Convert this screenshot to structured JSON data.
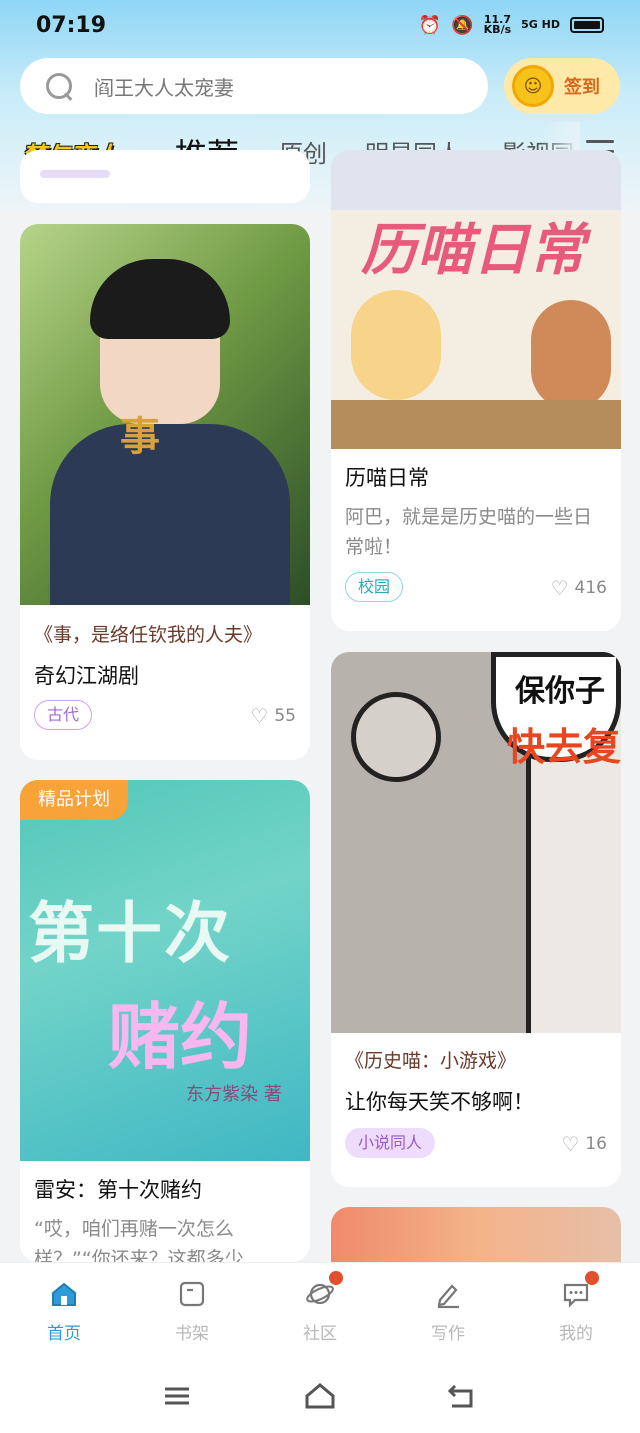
{
  "status": {
    "time": "07:19",
    "net_speed": "11.7",
    "net_unit": "KB/s",
    "signal": "5G HD"
  },
  "search": {
    "placeholder": "阎王大人太宠妻"
  },
  "signin": {
    "label": "签到"
  },
  "tabs": {
    "logo": "梦与恋人",
    "items": [
      "推荐",
      "原创",
      "明星同人",
      "影视同"
    ]
  },
  "feed": {
    "left": [
      {
        "quote": "《事，是络任钦我的人夫》",
        "title": "奇幻江湖剧",
        "tag": "古代",
        "likes": "55"
      },
      {
        "badge": "精品计划",
        "cover_title_top": "第十次",
        "cover_title_bottom": "赌约",
        "cover_author": "东方紫染 著",
        "title": "雷安：第十次赌约",
        "desc": "“哎，咱们再赌一次怎么样？”“你还来？这都多少…"
      }
    ],
    "right": [
      {
        "cover_text": "历喵日常",
        "title": "历喵日常",
        "desc": "阿巴，就是是历史喵的一些日常啦！",
        "tag": "校园",
        "likes": "416"
      },
      {
        "cover_text_top": "保你子",
        "cover_text_mid": "快去复",
        "quote": "《历史喵：小游戏》",
        "title": "让你每天笑不够啊！",
        "tag": "小说同人",
        "likes": "16"
      }
    ]
  },
  "bottom_nav": [
    {
      "label": "首页",
      "icon": "home-icon",
      "active": true
    },
    {
      "label": "书架",
      "icon": "bookshelf-icon"
    },
    {
      "label": "社区",
      "icon": "planet-icon",
      "dot": true
    },
    {
      "label": "写作",
      "icon": "pen-icon"
    },
    {
      "label": "我的",
      "icon": "message-icon",
      "dot": true
    }
  ],
  "colors": {
    "accent": "#2c9bd6",
    "signin_bg": "#ffe9a8",
    "badge": "#f7a33a"
  }
}
